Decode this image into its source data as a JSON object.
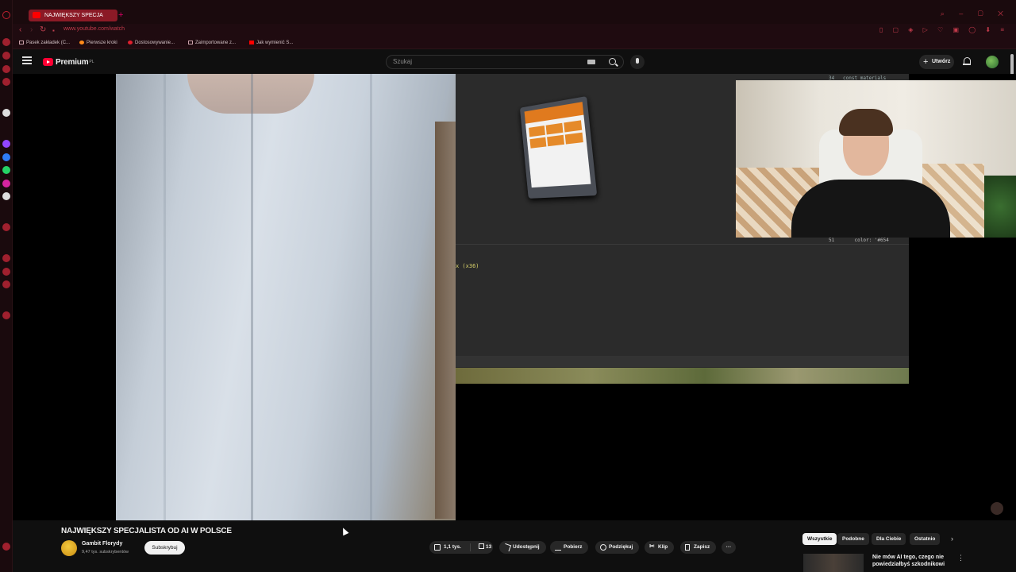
{
  "browser": {
    "tab_title": "NAJWIĘKSZY SPECJA",
    "new_tab": "+",
    "url": "www.youtube.com/watch",
    "bookmarks": [
      "Pasek zakładek (C...",
      "Pierwsze kroki",
      "Dostosowywanie...",
      "Zaimportowane z...",
      "Jak wymienić S..."
    ],
    "accent_color": "#c03a4a"
  },
  "header": {
    "logo_text": "Premium",
    "logo_region": "PL",
    "search_placeholder": "Szukaj",
    "create_label": "Utwórz"
  },
  "player": {
    "code_line": "x (x36)",
    "code_top": "34   const materials",
    "code_bottom": "51       color: '#654"
  },
  "video": {
    "title": "NAJWIĘKSZY SPECJALISTA OD AI W POLSCE",
    "channel_name": "Gambit Florydy",
    "channel_subs": "9,47 tys. subskrybentów",
    "subscribe_label": "Subskrybuj",
    "likes": "1,1 tys.",
    "dislikes": "13",
    "share_label": "Udostępnij",
    "download_label": "Pobierz",
    "thanks_label": "Podziękuj",
    "clip_label": "Klip",
    "save_label": "Zapisz",
    "more_label": "···"
  },
  "recommendations": {
    "chips": [
      "Wszystkie",
      "Podobne",
      "Dla Ciebie",
      "Ostatnio"
    ],
    "first_title": "Nie mów AI tego, czego nie powiedziałbyś szkodnikowi"
  }
}
